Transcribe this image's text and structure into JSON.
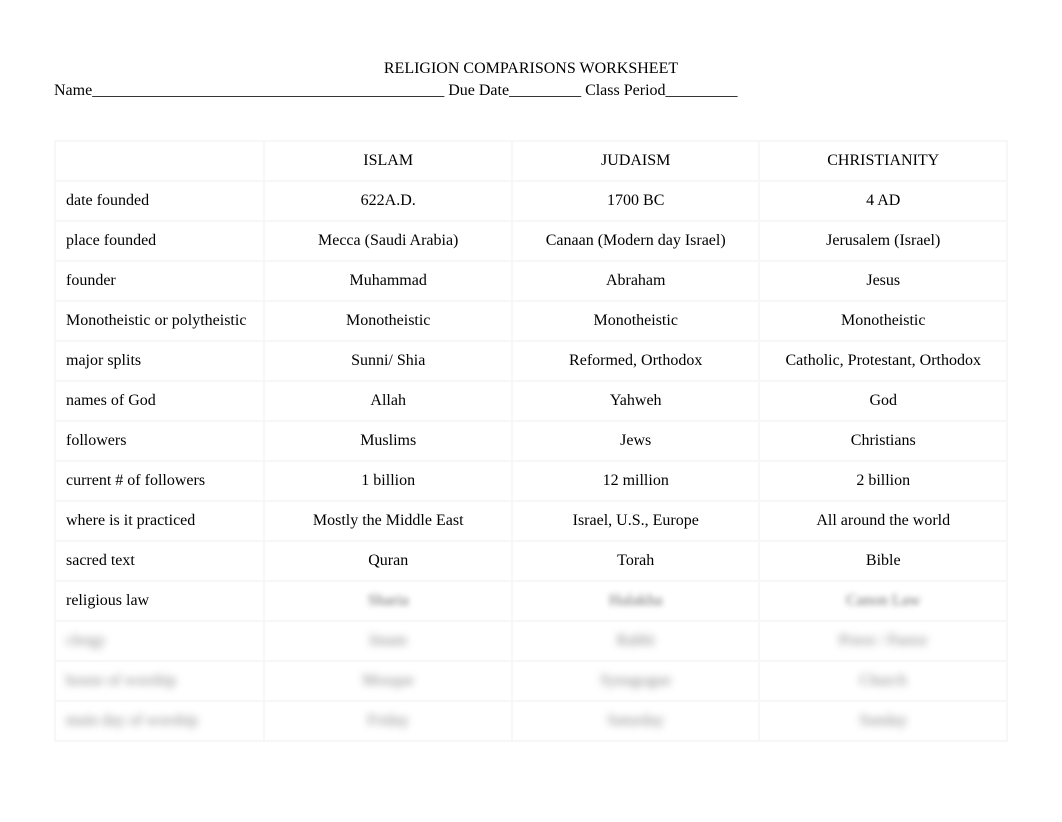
{
  "title": "RELIGION COMPARISONS WORKSHEET",
  "header_line": "Name____________________________________________ Due Date_________ Class Period_________",
  "columns": {
    "islam": "ISLAM",
    "judaism": "JUDAISM",
    "christianity": "CHRISTIANITY"
  },
  "rows": [
    {
      "label": "date founded",
      "islam": "622A.D.",
      "judaism": "1700 BC",
      "christianity": "4 AD"
    },
    {
      "label": "place founded",
      "islam": "Mecca (Saudi Arabia)",
      "judaism": "Canaan (Modern day Israel)",
      "christianity": "Jerusalem (Israel)"
    },
    {
      "label": "founder",
      "islam": "Muhammad",
      "judaism": "Abraham",
      "christianity": "Jesus"
    },
    {
      "label": "Monotheistic or polytheistic",
      "islam": "Monotheistic",
      "judaism": "Monotheistic",
      "christianity": "Monotheistic"
    },
    {
      "label": "major splits",
      "islam": "Sunni/ Shia",
      "judaism": "Reformed, Orthodox",
      "christianity": "Catholic, Protestant, Orthodox"
    },
    {
      "label": "names of God",
      "islam": "Allah",
      "judaism": "Yahweh",
      "christianity": "God"
    },
    {
      "label": "followers",
      "islam": "Muslims",
      "judaism": "Jews",
      "christianity": "Christians"
    },
    {
      "label": "current # of followers",
      "islam": "1 billion",
      "judaism": "12 million",
      "christianity": "2 billion"
    },
    {
      "label": "where is it practiced",
      "islam": "Mostly the Middle East",
      "judaism": "Israel, U.S., Europe",
      "christianity": "All around the world"
    },
    {
      "label": "sacred text",
      "islam": "Quran",
      "judaism": "Torah",
      "christianity": "Bible"
    },
    {
      "label": "religious law",
      "islam": "Sharia",
      "judaism": "Halakha",
      "christianity": "Canon Law"
    },
    {
      "label": "clergy",
      "islam": "Imam",
      "judaism": "Rabbi",
      "christianity": "Priest / Pastor"
    },
    {
      "label": "house of worship",
      "islam": "Mosque",
      "judaism": "Synagogue",
      "christianity": "Church"
    },
    {
      "label": "main day of worship",
      "islam": "Friday",
      "judaism": "Saturday",
      "christianity": "Sunday"
    }
  ]
}
